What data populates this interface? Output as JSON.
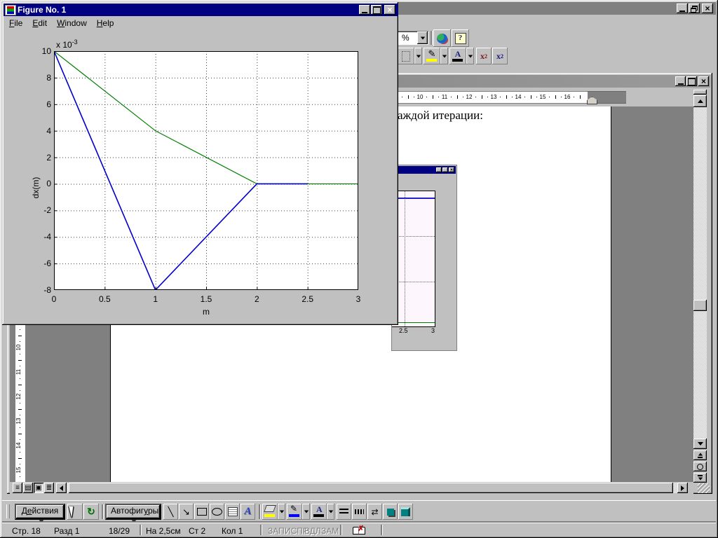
{
  "matlab_window": {
    "title": "Figure No. 1",
    "menu_items": [
      "File",
      "Edit",
      "Window",
      "Help"
    ],
    "chart_data": {
      "type": "line",
      "title": "",
      "xlabel": "m",
      "ylabel": "dx(m)",
      "y_scale_label": "x 10",
      "y_scale_exp": "-3",
      "x_ticks": [
        "0",
        "0.5",
        "1",
        "1.5",
        "2",
        "2.5",
        "3"
      ],
      "y_ticks": [
        "10",
        "8",
        "6",
        "4",
        "2",
        "0",
        "-2",
        "-4",
        "-6",
        "-8"
      ],
      "xlim": [
        0,
        3
      ],
      "ylim_e3": [
        -8,
        10
      ],
      "grid": true,
      "legend": null,
      "series": [
        {
          "name": "green-curve",
          "color": "#007f00",
          "width": 1.2,
          "x": [
            0,
            1,
            2,
            3
          ],
          "y_e3": [
            10,
            4,
            0,
            0
          ]
        },
        {
          "name": "blue-curve",
          "color": "#0000cc",
          "width": 1.6,
          "x": [
            0,
            1,
            2,
            2.5
          ],
          "y_e3": [
            10,
            -8,
            0,
            0
          ]
        }
      ]
    }
  },
  "word": {
    "standard_toolbar": {
      "zoom_value": "%"
    },
    "formatting_toolbar": {
      "sup_base": "x",
      "sup_exp": "2",
      "sub_base": "x",
      "sub_sub": "2"
    },
    "h_ruler": {
      "numbers": [
        "10",
        "11",
        "12",
        "13",
        "14",
        "15",
        "16"
      ]
    },
    "v_ruler": {
      "numbers": [
        "10",
        "11",
        "12",
        "13",
        "14",
        "15"
      ]
    },
    "document": {
      "visible_text": "аждой итерации:",
      "embedded_figure": {
        "x_tick_labels": [
          "2.5",
          "3"
        ],
        "top_line_color": "#2222cc",
        "bottom_line_color": "#007f00"
      }
    },
    "drawing_toolbar": {
      "actions": {
        "pre": "Д",
        "key": "е",
        "post": "йствия"
      },
      "autoshapes": {
        "pre": "Автофиг",
        "key": "у",
        "post": "ры"
      },
      "wordart_label": "A"
    },
    "status_bar": {
      "page": "Стр. 18",
      "section": "Разд 1",
      "page_of": "18/29",
      "at": "На 2,5см",
      "line": "Ст 2",
      "col": "Кол 1",
      "indicators": [
        "ЗАП",
        "ИСПР",
        "ВДЛ",
        "ЗАМ"
      ]
    },
    "colors": {
      "highlight": "#ffff00",
      "line_color": "#0000ff",
      "font_color": "#000000",
      "fill_color": "#ffff00"
    }
  }
}
